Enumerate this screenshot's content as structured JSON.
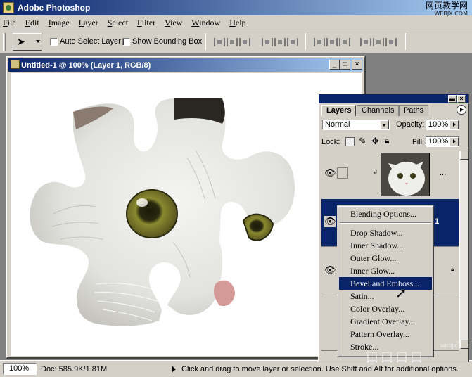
{
  "app": {
    "title": "Adobe Photoshop"
  },
  "watermark": {
    "top": "网页教学网",
    "top_sub": "WEBJX.COM",
    "bottom": "webjx",
    "bottom2": "口口口口"
  },
  "menu": [
    "File",
    "Edit",
    "Image",
    "Layer",
    "Select",
    "Filter",
    "View",
    "Window",
    "Help"
  ],
  "options": {
    "auto_select_label": "Auto Select Layer",
    "show_bounding_label": "Show Bounding Box",
    "auto_select_checked": false,
    "show_bounding_checked": false
  },
  "document": {
    "title": "Untitled-1 @ 100% (Layer 1, RGB/8)",
    "min": "_",
    "max": "□",
    "close": "×"
  },
  "status": {
    "zoom": "100%",
    "doc_size": "Doc: 585.9K/1.81M",
    "hint": "Click and drag to move layer or selection.  Use Shift and Alt for additional options."
  },
  "layers_panel": {
    "tabs": [
      "Layers",
      "Channels",
      "Paths"
    ],
    "active_tab": "Layers",
    "blend_mode": "Normal",
    "opacity_label": "Opacity:",
    "opacity": "100%",
    "lock_label": "Lock:",
    "fill_label": "Fill:",
    "fill": "100%",
    "layer_extra": "...",
    "layer_number": "1"
  },
  "context_menu": {
    "items": [
      "Blending Options...",
      "Drop Shadow...",
      "Inner Shadow...",
      "Outer Glow...",
      "Inner Glow...",
      "Bevel and Emboss...",
      "Satin...",
      "Color Overlay...",
      "Gradient Overlay...",
      "Pattern Overlay...",
      "Stroke..."
    ],
    "highlighted": "Bevel and Emboss..."
  },
  "colors": {
    "titlebar": "#0a246a",
    "highlight": "#0a246a",
    "chrome": "#d4d0c8"
  }
}
